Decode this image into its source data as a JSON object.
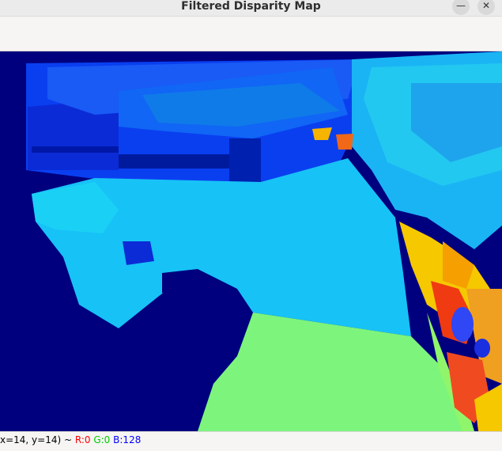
{
  "window": {
    "title": "Filtered Disparity Map",
    "minimize_glyph": "—",
    "close_glyph": "✕"
  },
  "status": {
    "coords": "x=14, y=14) ~ ",
    "r": "R:0",
    "g": "G:0",
    "b": "B:128"
  },
  "colors": {
    "background_disparity": "#00007f",
    "near_green": "#7df57d",
    "mid_cyan": "#17c2f7",
    "far_blue": "#0a3ff0",
    "hot_yellow": "#f5c800",
    "hot_red": "#f03a12"
  }
}
